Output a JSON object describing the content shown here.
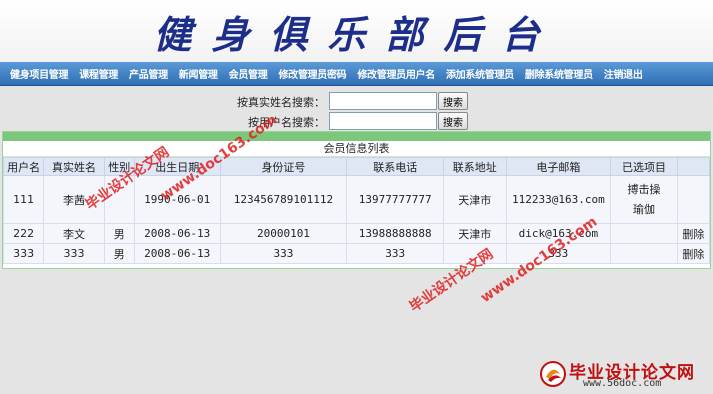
{
  "header": {
    "title": "健身俱乐部后台"
  },
  "nav": [
    "健身项目管理",
    "课程管理",
    "产品管理",
    "新闻管理",
    "会员管理",
    "修改管理员密码",
    "修改管理员用户名",
    "添加系统管理员",
    "删除系统管理员",
    "注销退出"
  ],
  "search": {
    "realname_label": "按真实姓名搜索：",
    "realname_value": "",
    "username_label": "按用户名搜索：",
    "username_value": "",
    "button_label": "搜索"
  },
  "list": {
    "caption": "会员信息列表",
    "columns": [
      "用户名",
      "真实姓名",
      "性别",
      "出生日期",
      "身份证号",
      "联系电话",
      "联系地址",
      "电子邮箱",
      "已选项目",
      ""
    ],
    "rows": [
      {
        "username": "111",
        "realname": "李茜",
        "gender": "",
        "birthday": "1990-06-01",
        "idcard": "123456789101112",
        "phone": "13977777777",
        "address": "天津市",
        "email": "112233@163.com",
        "projects": [
          "搏击操",
          "瑜伽"
        ],
        "action": ""
      },
      {
        "username": "222",
        "realname": "李文",
        "gender": "男",
        "birthday": "2008-06-13",
        "idcard": "20000101",
        "phone": "13988888888",
        "address": "天津市",
        "email": "dick@163.com",
        "projects": [],
        "action": "删除"
      },
      {
        "username": "333",
        "realname": "333",
        "gender": "男",
        "birthday": "2008-06-13",
        "idcard": "333",
        "phone": "333",
        "address": "",
        "email": "333",
        "projects": [],
        "action": "删除"
      }
    ]
  },
  "watermarks": {
    "text_a": "毕业设计论文网",
    "text_b": "www.doc163.com"
  },
  "footer_logo": {
    "title": "毕业设计论文网",
    "url": "www.56doc.com"
  }
}
